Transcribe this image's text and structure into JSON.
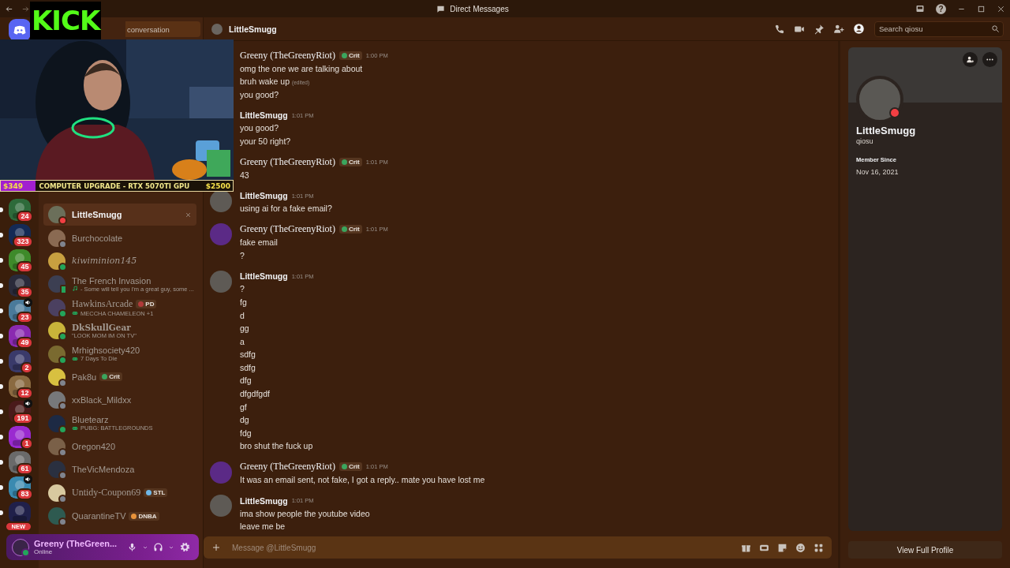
{
  "title_bar": {
    "title": "Direct Messages",
    "help": "?"
  },
  "overlay": {
    "logo": "KICK",
    "goal": {
      "current": "$349",
      "label": "COMPUTER UPGRADE - RTX 5070TI GPU",
      "target": "$2500",
      "level": 0.15
    }
  },
  "servers": [
    {
      "kind": "count",
      "badge": "24",
      "speaker": false
    },
    {
      "kind": "count",
      "badge": "323",
      "speaker": false
    },
    {
      "kind": "count",
      "badge": "45",
      "speaker": false
    },
    {
      "kind": "count",
      "badge": "35",
      "speaker": false
    },
    {
      "kind": "count",
      "badge": "23",
      "speaker": true
    },
    {
      "kind": "count",
      "badge": "49",
      "speaker": false
    },
    {
      "kind": "count",
      "badge": "2",
      "speaker": false
    },
    {
      "kind": "count",
      "badge": "12",
      "speaker": false
    },
    {
      "kind": "count",
      "badge": "191",
      "speaker": true
    },
    {
      "kind": "count",
      "badge": "1",
      "speaker": false
    },
    {
      "kind": "count",
      "badge": "61",
      "speaker": false
    },
    {
      "kind": "count",
      "badge": "83",
      "speaker": true
    },
    {
      "kind": "new",
      "badge": "NEW",
      "speaker": false
    }
  ],
  "dm_search": {
    "label": "conversation"
  },
  "dms": [
    {
      "name": "LittleSmugg",
      "color": "#f23f43",
      "mobile": false,
      "selected": true,
      "kind": "plain"
    },
    {
      "name": "Burchocolate",
      "color": "#80848e",
      "mobile": false,
      "selected": false,
      "kind": "plain"
    },
    {
      "name": "kiwiminion145",
      "color": "#23a55a",
      "mobile": false,
      "selected": false,
      "kind": "script"
    },
    {
      "name": "The French Invasion",
      "color": "#23a55a",
      "mobile": true,
      "selected": false,
      "kind": "plain",
      "activity": {
        "kind": "music",
        "text": "- Some will tell you i'm a great guy, some ..."
      }
    },
    {
      "name": "HawkinsArcade",
      "color": "#23a55a",
      "mobile": false,
      "selected": false,
      "kind": "serif",
      "tag": {
        "text": "PD",
        "color": "#b03a3a"
      },
      "activity": {
        "kind": "game",
        "text": "MECCHA CHAMELEON +1"
      }
    },
    {
      "name": "DkSkullGear",
      "color": "#23a55a",
      "mobile": false,
      "selected": false,
      "kind": "bold-serif",
      "activity": {
        "kind": "custom",
        "text": "\"LOOK MOM IM ON TV\""
      }
    },
    {
      "name": "Mrhighsociety420",
      "color": "#23a55a",
      "mobile": false,
      "selected": false,
      "kind": "plain",
      "activity": {
        "kind": "game",
        "text": "7 Days To Die"
      }
    },
    {
      "name": "Pak8u",
      "color": "#80848e",
      "mobile": false,
      "selected": false,
      "kind": "plain",
      "tag": {
        "text": "Crit",
        "color": "#3ba55d"
      }
    },
    {
      "name": "xxBlack_Mildxx",
      "color": "#80848e",
      "mobile": false,
      "selected": false,
      "kind": "plain"
    },
    {
      "name": "Bluetearz",
      "color": "#23a55a",
      "mobile": false,
      "selected": false,
      "kind": "plain",
      "activity": {
        "kind": "game",
        "text": "PUBG: BATTLEGROUNDS"
      }
    },
    {
      "name": "Oregon420",
      "color": "#80848e",
      "mobile": false,
      "selected": false,
      "kind": "plain"
    },
    {
      "name": "TheVicMendoza",
      "color": "#80848e",
      "mobile": false,
      "selected": false,
      "kind": "plain"
    },
    {
      "name": "Untidy-Coupon69",
      "color": "#80848e",
      "mobile": false,
      "selected": false,
      "kind": "serif",
      "tag": {
        "text": "STL",
        "color": "#6fb7e8"
      }
    },
    {
      "name": "QuarantineTV",
      "color": "#80848e",
      "mobile": false,
      "selected": false,
      "kind": "plain",
      "tag": {
        "text": "DNBA",
        "color": "#e8923a"
      }
    }
  ],
  "user_panel": {
    "name": "Greeny (TheGreen...",
    "status": "Online"
  },
  "chat": {
    "header": "LittleSmugg",
    "search_placeholder": "Search qiosu",
    "input_placeholder": "Message @LittleSmugg",
    "messages": [
      {
        "author": "Greeny (TheGreenyRiot)",
        "kind": "serif",
        "tag": {
          "text": "Crit",
          "color": "#3ba55d"
        },
        "time": "1:00 PM",
        "lines": [
          {
            "text": "omg the one we are talking about"
          },
          {
            "text": "bruh wake up",
            "edited": "(edited)"
          },
          {
            "text": "you good?"
          }
        ]
      },
      {
        "author": "LittleSmugg",
        "kind": "plain",
        "time": "1:01 PM",
        "lines": [
          {
            "text": "you good?"
          },
          {
            "text": "your 50 right?"
          }
        ]
      },
      {
        "author": "Greeny (TheGreenyRiot)",
        "kind": "serif",
        "tag": {
          "text": "Crit",
          "color": "#3ba55d"
        },
        "time": "1:01 PM",
        "lines": [
          {
            "text": "43"
          }
        ]
      },
      {
        "author": "LittleSmugg",
        "kind": "plain",
        "color": "#5e5a55",
        "time": "1:01 PM",
        "lines": [
          {
            "text": "using ai for a fake email?"
          }
        ]
      },
      {
        "author": "Greeny (TheGreenyRiot)",
        "kind": "serif",
        "color": "#5b2a86",
        "tag": {
          "text": "Crit",
          "color": "#3ba55d"
        },
        "time": "1:01 PM",
        "lines": [
          {
            "text": "fake email"
          },
          {
            "text": "?"
          }
        ]
      },
      {
        "author": "LittleSmugg",
        "kind": "plain",
        "color": "#5e5a55",
        "time": "1:01 PM",
        "lines": [
          {
            "text": "?"
          },
          {
            "text": "fg"
          },
          {
            "text": "d"
          },
          {
            "text": "gg"
          },
          {
            "text": "a"
          },
          {
            "text": "sdfg"
          },
          {
            "text": "sdfg"
          },
          {
            "text": "dfg"
          },
          {
            "text": "dfgdfgdf"
          },
          {
            "text": "gf"
          },
          {
            "text": "dg"
          },
          {
            "text": "fdg"
          },
          {
            "text": "bro shut the fuck up"
          }
        ]
      },
      {
        "author": "Greeny (TheGreenyRiot)",
        "kind": "serif",
        "color": "#5b2a86",
        "tag": {
          "text": "Crit",
          "color": "#3ba55d"
        },
        "time": "1:01 PM",
        "lines": [
          {
            "text": "It was an email sent, not fake, I got a reply.. mate you have lost me"
          }
        ]
      },
      {
        "author": "LittleSmugg",
        "kind": "plain",
        "color": "#5e5a55",
        "time": "1:01 PM",
        "lines": [
          {
            "text": "ima show people the youtube video"
          },
          {
            "text": "leave me be"
          }
        ]
      }
    ]
  },
  "profile": {
    "name": "LittleSmugg",
    "username": "qiosu",
    "member_since_label": "Member Since",
    "member_since": "Nov 16, 2021",
    "button": "View Full Profile"
  }
}
